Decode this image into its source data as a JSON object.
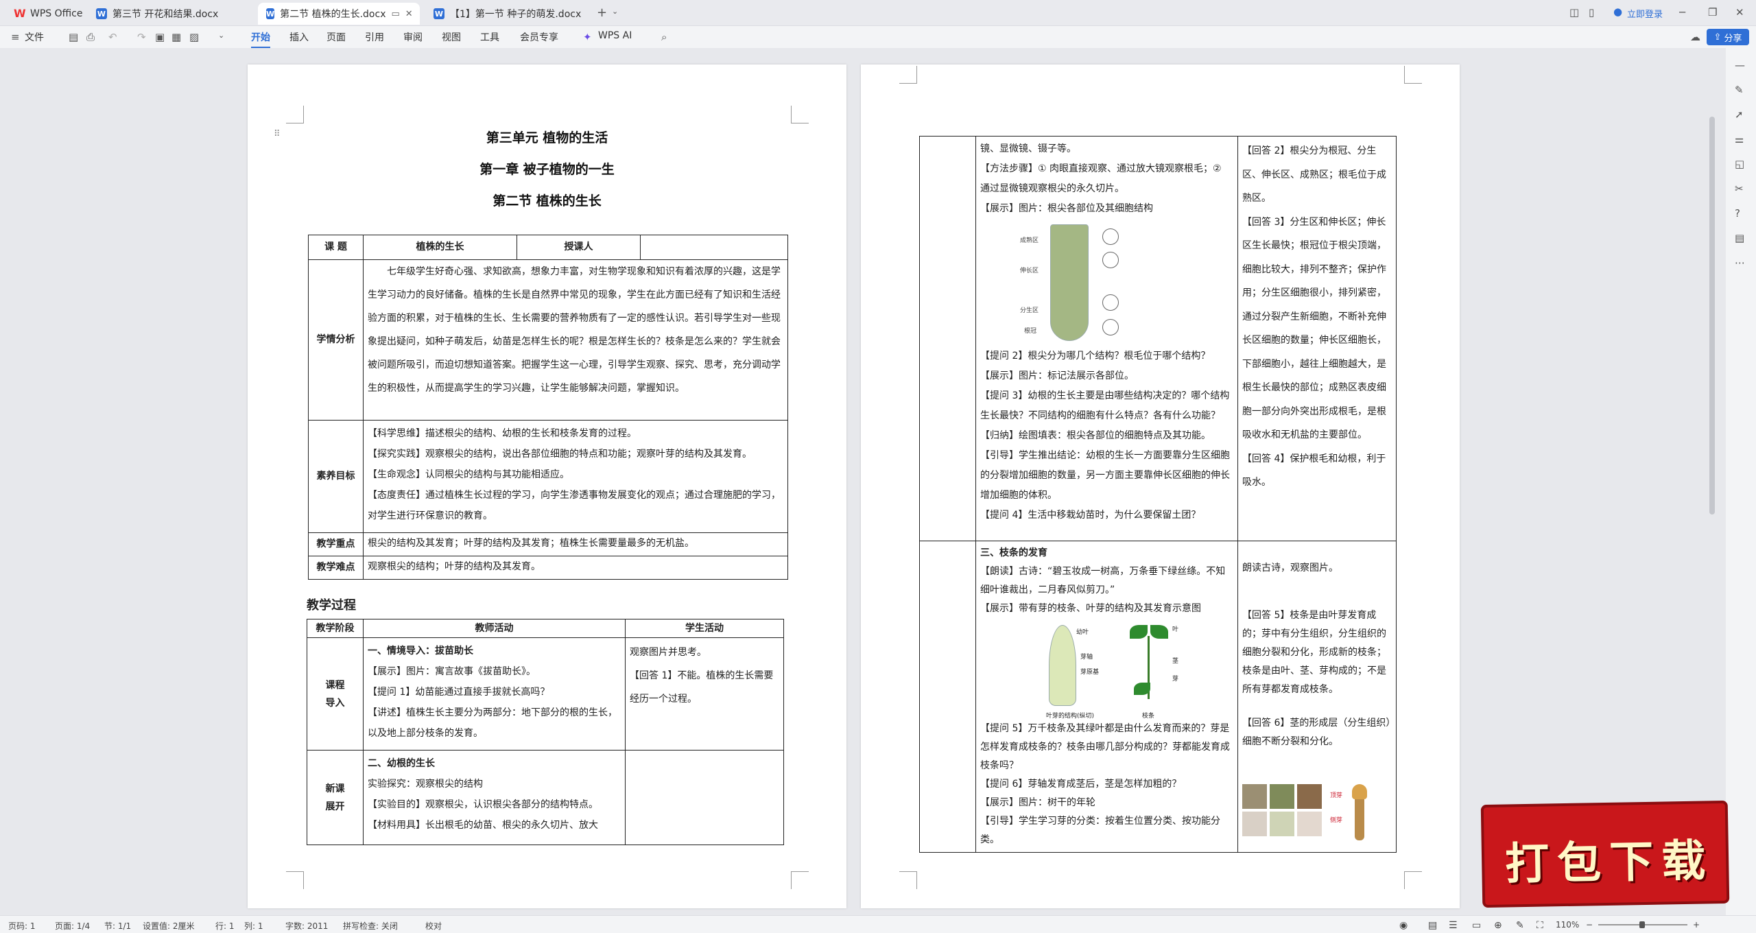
{
  "tabs": [
    {
      "label": "WPS Office",
      "kind": "wps"
    },
    {
      "label": "第三节  开花和结果.docx",
      "kind": "w"
    },
    {
      "label": "第二节  植株的生长.docx",
      "kind": "w",
      "active": true
    },
    {
      "label": "【1】第一节  种子的萌发.docx",
      "kind": "w"
    }
  ],
  "titlebar": {
    "login": "立即登录"
  },
  "menu": {
    "file": "文件",
    "items": [
      "开始",
      "插入",
      "页面",
      "引用",
      "审阅",
      "视图",
      "工具",
      "会员专享",
      "WPS AI"
    ],
    "active": "开始",
    "share": "分享"
  },
  "doc_left": {
    "titles": [
      "第三单元   植物的生活",
      "第一章   被子植物的一生",
      "第二节   植株的生长"
    ],
    "info_table": {
      "course_label": "课      题",
      "course_value": "植株的生长",
      "teacher_label": "授课人",
      "teacher_value": "",
      "rows": [
        {
          "label": "学情分析",
          "text": "七年级学生好奇心强、求知欲高，想象力丰富，对生物学现象和知识有着浓厚的兴趣，这是学生学习动力的良好储备。植株的生长是自然界中常见的现象，学生在此方面已经有了知识和生活经验方面的积累，对于植株的生长、生长需要的营养物质有了一定的感性认识。若引导学生对一些现象提出疑问，如种子萌发后，幼苗是怎样生长的呢？根是怎样生长的？枝条是怎么来的？学生就会被问题所吸引，而迫切想知道答案。把握学生这一心理，引导学生观察、探究、思考，充分调动学生的积极性，从而提高学生的学习兴趣，让学生能够解决问题，掌握知识。"
        },
        {
          "label": "素养目标",
          "lines": [
            "【科学思维】描述根尖的结构、幼根的生长和枝条发育的过程。",
            "【探究实践】观察根尖的结构，说出各部位细胞的特点和功能；观察叶芽的结构及其发育。",
            "【生命观念】认同根尖的结构与其功能相适应。",
            "【态度责任】通过植株生长过程的学习，向学生渗透事物发展变化的观点；通过合理施肥的学习，对学生进行环保意识的教育。"
          ]
        },
        {
          "label": "教学重点",
          "text": "根尖的结构及其发育；叶芽的结构及其发育；植株生长需要量最多的无机盐。"
        },
        {
          "label": "教学难点",
          "text": "观察根尖的结构；叶芽的结构及其发育。"
        }
      ]
    },
    "process_heading": "教学过程",
    "process_table": {
      "headers": [
        "教学阶段",
        "教师活动",
        "学生活动"
      ],
      "rows": [
        {
          "stage": "课程\n导入",
          "teacher": [
            "一、情境导入：拔苗助长",
            "【展示】图片：寓言故事《拔苗助长》。",
            "【提问 1】幼苗能通过直接手拔就长高吗？",
            "【讲述】植株生长主要分为两部分：地下部分的根的生长，以及地上部分枝条的发育。"
          ],
          "student": [
            "观察图片并思考。",
            "【回答 1】不能。植株的生长需要经历一个过程。"
          ]
        },
        {
          "stage": "新课\n展开",
          "teacher": [
            "二、幼根的生长",
            "实验探究：观察根尖的结构",
            "【实验目的】观察根尖，认识根尖各部分的结构特点。",
            "【材料用具】长出根毛的幼苗、根尖的永久切片、放大"
          ],
          "student": []
        }
      ]
    }
  },
  "doc_right": {
    "block1_teacher": [
      "镜、显微镜、镊子等。",
      "【方法步骤】① 肉眼直接观察、通过放大镜观察根毛；② 通过显微镜观察根尖的永久切片。",
      "【展示】图片：根尖各部位及其细胞结构",
      "【提问 2】根尖分为哪几个结构？根毛位于哪个结构？",
      "【展示】图片：标记法展示各部位。",
      "【提问 3】幼根的生长主要是由哪些结构决定的？哪个结构生长最快？不同结构的细胞有什么特点？各有什么功能？",
      "【归纳】绘图填表：根尖各部位的细胞特点及其功能。",
      "【引导】学生推出结论：幼根的生长一方面要靠分生区细胞的分裂增加细胞的数量，另一方面主要靠伸长区细胞的伸长增加细胞的体积。",
      "【提问 4】生活中移栽幼苗时，为什么要保留土团？"
    ],
    "root_labels": [
      "成熟区",
      "伸长区",
      "分生区",
      "根冠"
    ],
    "block1_student": [
      "【回答 2】根尖分为根冠、分生区、伸长区、成熟区；根毛位于成熟区。",
      "【回答 3】分生区和伸长区；伸长区生长最快；根冠位于根尖顶端，细胞比较大，排列不整齐；保护作用；分生区细胞很小，排列紧密，通过分裂产生新细胞，不断补充伸长区细胞的数量；伸长区细胞长，下部细胞小，越往上细胞越大，是根生长最快的部位；成熟区表皮细胞一部分向外突出形成根毛，是根吸收水和无机盐的主要部位。",
      "【回答 4】保护根毛和幼根，利于吸水。"
    ],
    "block2_teacher": [
      "三、枝条的发育",
      "【朗读】古诗：“碧玉妆成一树高，万条垂下绿丝绦。不知细叶谁裁出，二月春风似剪刀。”",
      "【展示】带有芽的枝条、叶芽的结构及其发育示意图",
      "【提问 5】万千枝条及其绿叶都是由什么发育而来的？芽是怎样发育成枝条的？枝条由哪几部分构成的？芽都能发育成枝条吗？",
      "【提问 6】芽轴发育成茎后，茎是怎样加粗的？",
      "【展示】图片：树干的年轮",
      "【引导】学生学习芽的分类：按着生位置分类、按功能分类。"
    ],
    "bud_labels": [
      "幼叶",
      "芽轴",
      "芽原基",
      "叶芽的结构(纵切)",
      "叶",
      "茎",
      "芽",
      "枝条"
    ],
    "flower_labels": [
      "顶芽",
      "侧芽"
    ],
    "block2_student": [
      "朗读古诗，观察图片。",
      "【回答 5】枝条是由叶芽发育成的；芽中有分生组织，分生组织的细胞分裂和分化，形成新的枝条；枝条是由叶、茎、芽构成的；不是所有芽都发育成枝条。",
      "【回答 6】茎的形成层（分生组织）细胞不断分裂和分化。"
    ]
  },
  "statusbar": {
    "page": "页码: 1",
    "pages": "页面: 1/4",
    "section": "节: 1/1",
    "setting": "设置值: 2厘米",
    "row": "行: 1",
    "col": "列: 1",
    "words": "字数: 2011",
    "spell": "拼写检查: 关闭",
    "proof": "校对",
    "zoom": "110%"
  },
  "banner": {
    "text": "打包下载"
  }
}
